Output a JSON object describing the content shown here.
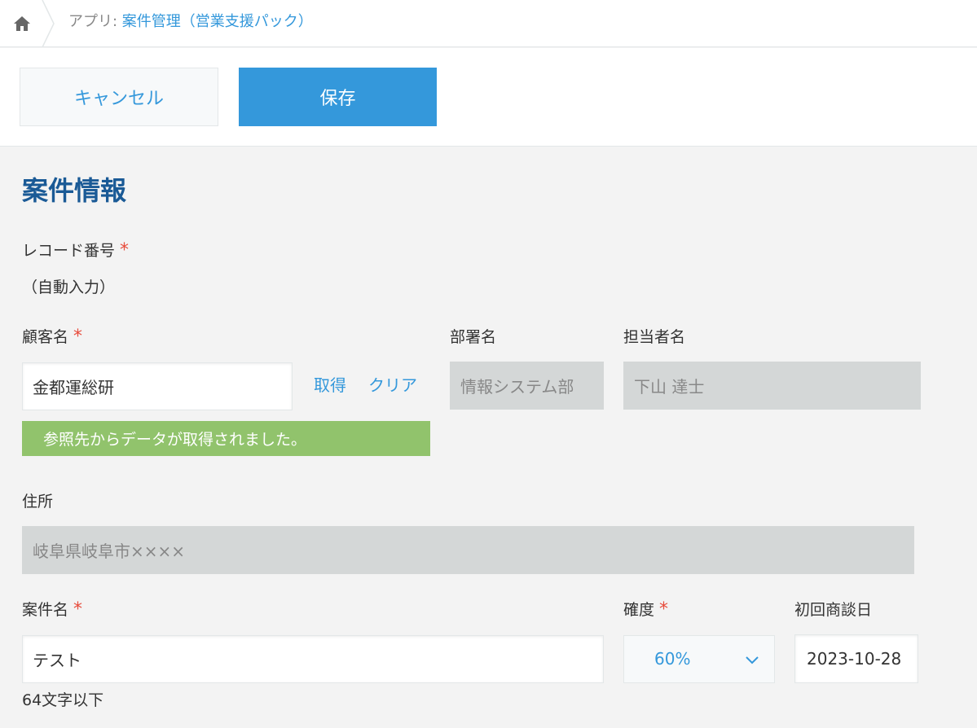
{
  "breadcrumb": {
    "prefix": "アプリ: ",
    "app_name": "案件管理（営業支援パック）"
  },
  "toolbar": {
    "cancel_label": "キャンセル",
    "save_label": "保存"
  },
  "section": {
    "title": "案件情報"
  },
  "form": {
    "record_no": {
      "label": "レコード番号",
      "value": "（自動入力）",
      "required_mark": "*"
    },
    "customer": {
      "label": "顧客名",
      "required_mark": "*",
      "value": "金都運総研",
      "fetch_label": "取得",
      "clear_label": "クリア",
      "notice": "参照先からデータが取得されました。"
    },
    "department": {
      "label": "部署名",
      "value": "情報システム部"
    },
    "person": {
      "label": "担当者名",
      "value": "下山 達士"
    },
    "address": {
      "label": "住所",
      "value": "岐阜県岐阜市××××"
    },
    "deal_name": {
      "label": "案件名",
      "required_mark": "*",
      "value": "テスト",
      "hint": "64文字以下"
    },
    "probability": {
      "label": "確度",
      "required_mark": "*",
      "value": "60%"
    },
    "first_meeting": {
      "label": "初回商談日",
      "value": "2023-10-28"
    }
  },
  "colors": {
    "accent": "#3498db",
    "title": "#1a5a96",
    "required": "#e74c3c",
    "notice": "#91c36c",
    "readonly": "#d4d7d7"
  },
  "icons": {
    "home": "home-icon",
    "dropdown": "chevron-down-icon"
  }
}
